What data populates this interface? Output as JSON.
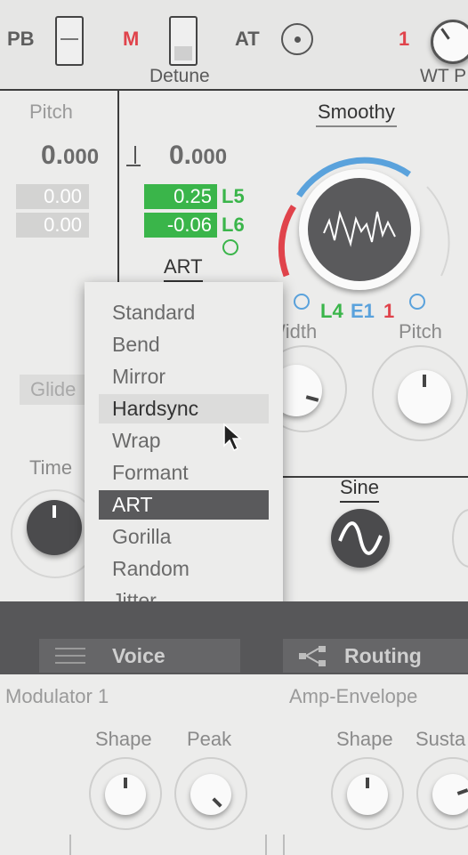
{
  "topbar": {
    "pb_label": "PB",
    "m_label": "M",
    "detune_label": "Detune",
    "at_label": "AT",
    "one_label": "1",
    "wt_label": "WT P"
  },
  "pitch_panel": {
    "title": "Pitch",
    "value_int": "0.",
    "value_dec": "000",
    "box1": "0.00",
    "box2": "0.00",
    "glide_label": "Glide",
    "time_label": "Time"
  },
  "osc_panel": {
    "note_value_int": "0.",
    "note_value_dec": "000",
    "mod1_value": "0.25",
    "mod1_label": "L5",
    "mod2_value": "-0.06",
    "mod2_label": "L6",
    "mode_label": "ART",
    "wave_title": "Smoothy",
    "mod_tag_l4": "L4",
    "mod_tag_e1": "E1",
    "mod_tag_1": "1",
    "width_label": "Width",
    "pitch_label": "Pitch",
    "sine_label": "Sine"
  },
  "dropdown": {
    "items": [
      "Standard",
      "Bend",
      "Mirror",
      "Hardsync",
      "Wrap",
      "Formant",
      "ART",
      "Gorilla",
      "Random",
      "Jitter"
    ],
    "hovered": "Hardsync",
    "selected": "ART"
  },
  "tabs": {
    "voice": "Voice",
    "routing": "Routing"
  },
  "bottom": {
    "modulator_title": "Modulator 1",
    "amp_title": "Amp-Envelope",
    "shape_label": "Shape",
    "peak_label": "Peak",
    "amp_shape_label": "Shape",
    "sustain_label": "Susta"
  },
  "colors": {
    "accent_red": "#e0434b",
    "accent_green": "#3ab54a",
    "accent_blue": "#5aa2dc",
    "dark": "#575759"
  },
  "icons": [
    "plus-minus-icon",
    "dot-button-icon",
    "note-icon",
    "cursor-icon",
    "sine-wave-icon",
    "menu-icon",
    "routing-icon"
  ]
}
